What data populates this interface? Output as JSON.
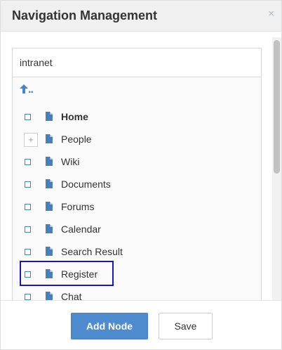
{
  "dialog": {
    "title": "Navigation Management",
    "close_icon": "close-icon",
    "close_glyph": "×"
  },
  "site_selector": {
    "value": "intranet"
  },
  "tree": {
    "up_label": "..",
    "up_icon": "up-arrow-icon",
    "nodes": [
      {
        "label": "Home",
        "bold": true,
        "has_children": false
      },
      {
        "label": "People",
        "bold": false,
        "has_children": true
      },
      {
        "label": "Wiki",
        "bold": false,
        "has_children": false
      },
      {
        "label": "Documents",
        "bold": false,
        "has_children": false
      },
      {
        "label": "Forums",
        "bold": false,
        "has_children": false
      },
      {
        "label": "Calendar",
        "bold": false,
        "has_children": false
      },
      {
        "label": "Search Result",
        "bold": false,
        "has_children": false
      },
      {
        "label": "Register",
        "bold": false,
        "has_children": false,
        "selected": true
      },
      {
        "label": "Chat",
        "bold": false,
        "has_children": false
      }
    ],
    "expander_glyph": "+",
    "file_icon": "file-icon"
  },
  "footer": {
    "add_node_label": "Add Node",
    "save_label": "Save"
  },
  "colors": {
    "accent": "#4f8bcf",
    "selection_border": "#1a1aa8",
    "header_bg": "#f0f0f0"
  }
}
